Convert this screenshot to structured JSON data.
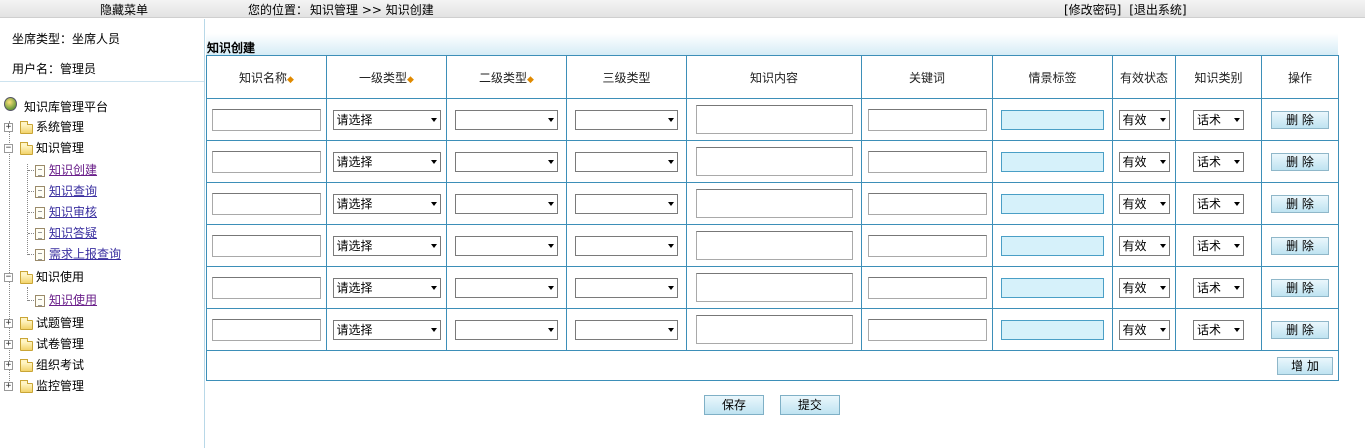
{
  "topbar": {
    "hide_menu": "隐藏菜单",
    "location_prefix": "您的位置：",
    "location_path": "知识管理 >> 知识创建",
    "change_password": "[修改密码]",
    "logout": "[退出系统]"
  },
  "sidebar": {
    "seat_type": "坐席类型：坐席人员",
    "username": "用户名：管理员",
    "root": "知识库管理平台",
    "system_mgmt": "系统管理",
    "knowledge_mgmt": "知识管理",
    "knowledge_items": [
      "知识创建",
      "知识查询",
      "知识审核",
      "知识答疑",
      "需求上报查询"
    ],
    "knowledge_use": "知识使用",
    "knowledge_use_items": [
      "知识使用"
    ],
    "exam_mgmt": "试题管理",
    "paper_mgmt": "试卷管理",
    "org_exam": "组织考试",
    "monitor_mgmt": "监控管理"
  },
  "main": {
    "title": "知识创建",
    "columns": [
      "知识名称",
      "一级类型",
      "二级类型",
      "三级类型",
      "知识内容",
      "关键词",
      "情景标签",
      "有效状态",
      "知识类别",
      "操作"
    ],
    "required_mark": "◆",
    "row_values": {
      "level1_select": "请选择",
      "status_select": "有效",
      "category_select": "话术",
      "delete_button": "删 除"
    },
    "row_count": 6,
    "add_button": "增 加",
    "save_button": "保存",
    "submit_button": "提交"
  }
}
